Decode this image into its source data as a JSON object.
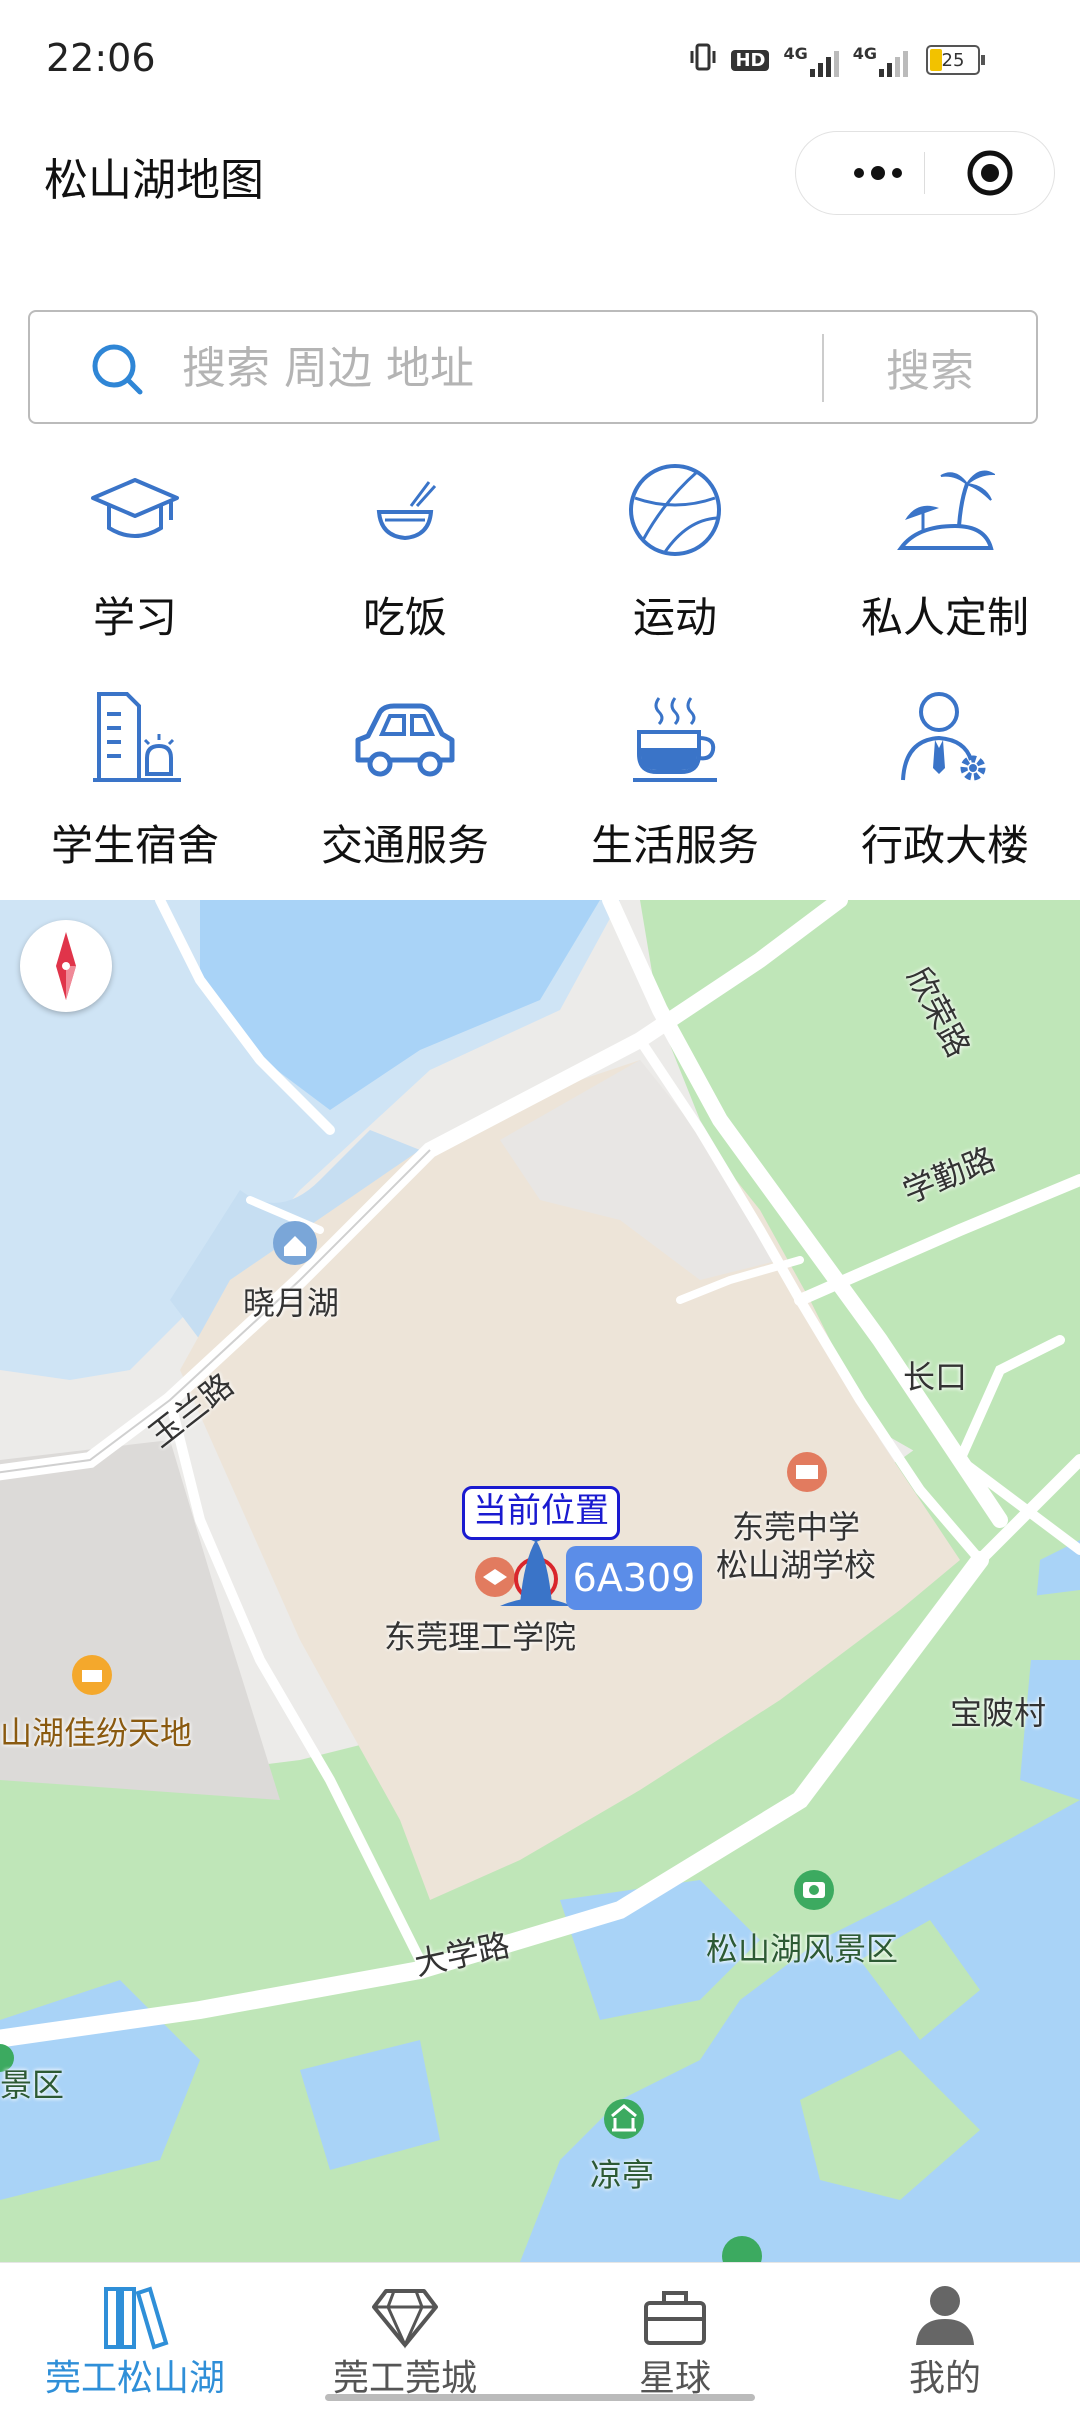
{
  "status_bar": {
    "time": "22:06",
    "network_1": "4G",
    "network_2": "4G",
    "hd_label": "HD",
    "battery": "25"
  },
  "title_bar": {
    "title": "松山湖地图"
  },
  "search": {
    "placeholder": "搜索 周边 地址",
    "button": "搜索"
  },
  "categories": [
    {
      "label": "学习",
      "icon": "graduation-cap-icon"
    },
    {
      "label": "吃饭",
      "icon": "rice-bowl-icon"
    },
    {
      "label": "运动",
      "icon": "basketball-icon"
    },
    {
      "label": "私人定制",
      "icon": "palm-island-icon"
    },
    {
      "label": "学生宿舍",
      "icon": "dormitory-building-icon"
    },
    {
      "label": "交通服务",
      "icon": "car-icon"
    },
    {
      "label": "生活服务",
      "icon": "coffee-cup-icon"
    },
    {
      "label": "行政大楼",
      "icon": "admin-person-gear-icon"
    }
  ],
  "map": {
    "labels": {
      "xiaoyue_lake": "晓月湖",
      "yulan_road": "玉兰路",
      "xindong_road": "欣荣路",
      "xueqin_road": "学勤路",
      "changkou": "长口",
      "dongguan_middle_school": "东莞中学\n松山湖学校",
      "dgut": "东莞理工学院",
      "jiafen": "山湖佳纷天地",
      "baoling_village": "宝陂村",
      "university_road": "大学路",
      "scenic_area": "松山湖风景区",
      "scenic_area_left": "景区",
      "pavilion": "凉亭"
    },
    "current_location_label": "当前位置",
    "room_badge": "6A309",
    "colors": {
      "water": "#a9d3f7",
      "green": "#bfe6b8",
      "campus": "#ede4d8",
      "road": "#ffffff",
      "marker_blue": "#3a74c8"
    }
  },
  "bottom_nav": {
    "tabs": [
      {
        "label": "莞工松山湖",
        "icon": "books-icon",
        "active": true
      },
      {
        "label": "莞工莞城",
        "icon": "diamond-icon",
        "active": false
      },
      {
        "label": "星球",
        "icon": "briefcase-icon",
        "active": false
      },
      {
        "label": "我的",
        "icon": "user-icon",
        "active": false
      }
    ],
    "active_color": "#2f8fd8"
  }
}
